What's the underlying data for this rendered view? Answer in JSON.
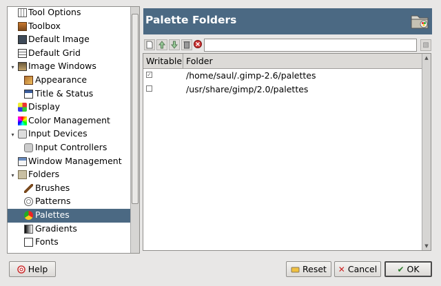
{
  "tree": {
    "items": [
      {
        "label": "Tool Options",
        "icon": "tool-options-icon",
        "level": 1,
        "expander": ""
      },
      {
        "label": "Toolbox",
        "icon": "toolbox-icon",
        "level": 1,
        "expander": ""
      },
      {
        "label": "Default Image",
        "icon": "default-image-icon",
        "level": 1,
        "expander": ""
      },
      {
        "label": "Default Grid",
        "icon": "default-grid-icon",
        "level": 1,
        "expander": ""
      },
      {
        "label": "Image Windows",
        "icon": "image-windows-icon",
        "level": 1,
        "expander": "▾"
      },
      {
        "label": "Appearance",
        "icon": "appearance-icon",
        "level": 2,
        "expander": ""
      },
      {
        "label": "Title & Status",
        "icon": "title-status-icon",
        "level": 2,
        "expander": ""
      },
      {
        "label": "Display",
        "icon": "display-icon",
        "level": 1,
        "expander": ""
      },
      {
        "label": "Color Management",
        "icon": "color-management-icon",
        "level": 1,
        "expander": ""
      },
      {
        "label": "Input Devices",
        "icon": "input-devices-icon",
        "level": 1,
        "expander": "▾"
      },
      {
        "label": "Input Controllers",
        "icon": "input-controllers-icon",
        "level": 2,
        "expander": ""
      },
      {
        "label": "Window Management",
        "icon": "window-management-icon",
        "level": 1,
        "expander": ""
      },
      {
        "label": "Folders",
        "icon": "folders-icon",
        "level": 1,
        "expander": "▾"
      },
      {
        "label": "Brushes",
        "icon": "brushes-icon",
        "level": 2,
        "expander": ""
      },
      {
        "label": "Patterns",
        "icon": "patterns-icon",
        "level": 2,
        "expander": ""
      },
      {
        "label": "Palettes",
        "icon": "palettes-icon",
        "level": 2,
        "expander": "",
        "selected": true
      },
      {
        "label": "Gradients",
        "icon": "gradients-icon",
        "level": 2,
        "expander": ""
      },
      {
        "label": "Fonts",
        "icon": "fonts-icon",
        "level": 2,
        "expander": ""
      }
    ]
  },
  "header": {
    "title": "Palette Folders",
    "icon": "palette-folder-icon"
  },
  "toolbar": {
    "buttons": [
      "new-folder-icon",
      "raise-folder-icon",
      "lower-folder-icon",
      "delete-folder-icon",
      "stop-icon"
    ],
    "path_value": "",
    "browse_icon": "folder-browse-icon"
  },
  "list": {
    "columns": [
      "Writable",
      "Folder"
    ],
    "rows": [
      {
        "writable": true,
        "folder": "/home/saul/.gimp-2.6/palettes"
      },
      {
        "writable": false,
        "folder": "/usr/share/gimp/2.0/palettes"
      }
    ]
  },
  "buttons": {
    "help": "Help",
    "reset": "Reset",
    "cancel": "Cancel",
    "ok": "OK"
  },
  "colors": {
    "accent": "#4b6983",
    "background": "#e8e7e6"
  }
}
